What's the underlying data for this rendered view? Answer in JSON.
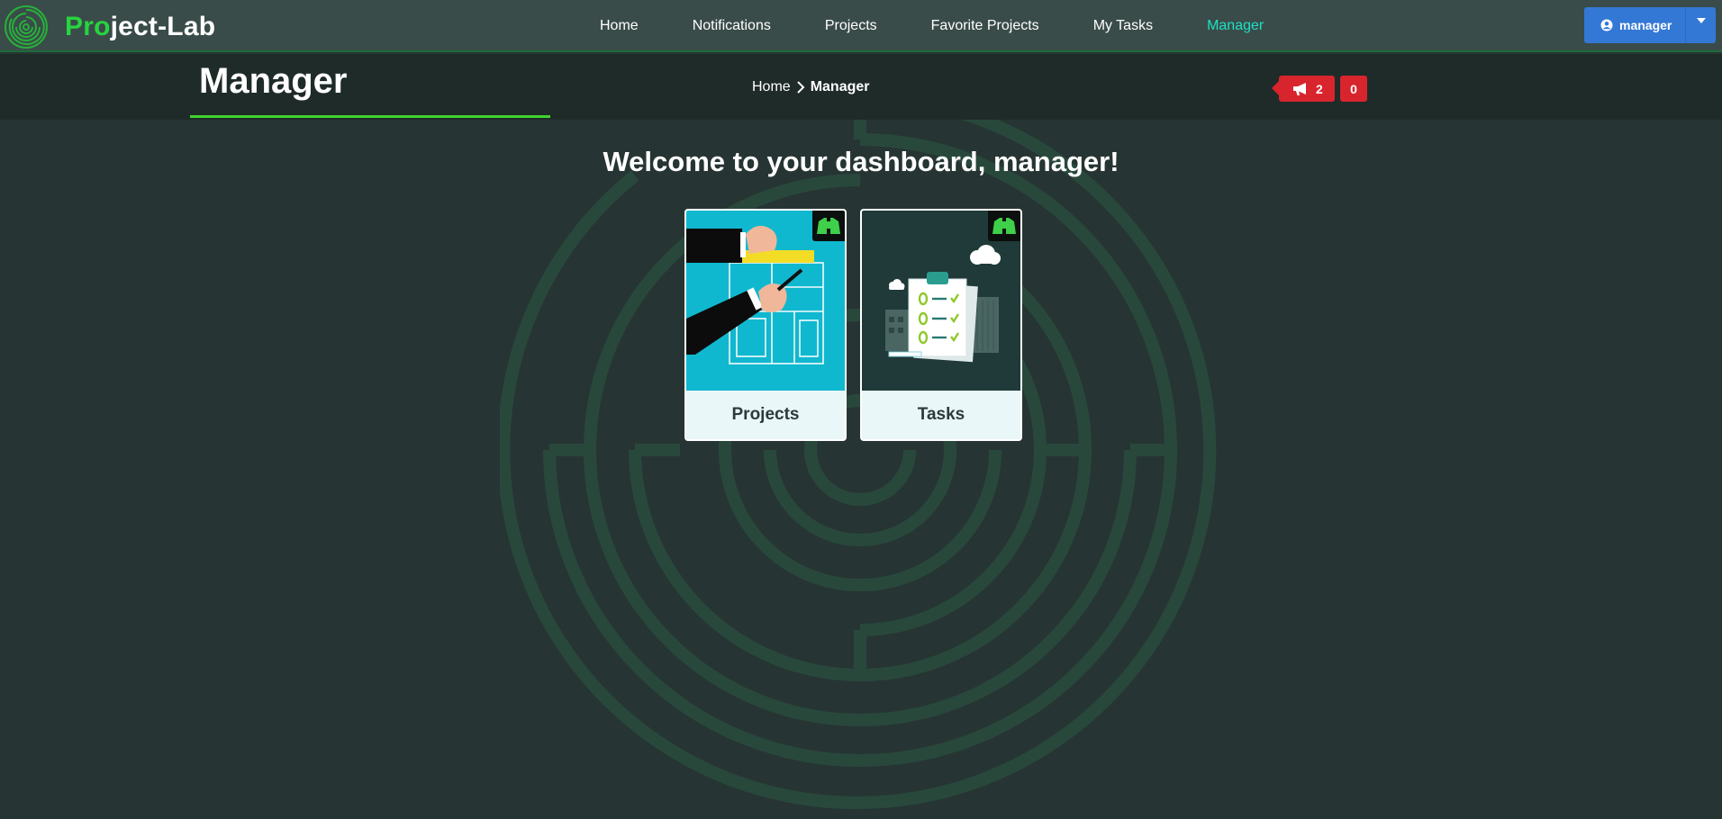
{
  "brand": {
    "part1": "Pro",
    "part2": "ject-Lab"
  },
  "nav": {
    "items": [
      {
        "label": "Home"
      },
      {
        "label": "Notifications"
      },
      {
        "label": "Projects"
      },
      {
        "label": "Favorite Projects"
      },
      {
        "label": "My Tasks"
      },
      {
        "label": "Manager",
        "active": true
      }
    ]
  },
  "user_menu": {
    "label": "manager",
    "icon": "user-circle-icon"
  },
  "header": {
    "title": "Manager",
    "breadcrumb": {
      "home": "Home",
      "current": "Manager"
    },
    "announcement_count": "2",
    "alert_count": "0"
  },
  "main": {
    "welcome": "Welcome to your dashboard, manager!",
    "cards": [
      {
        "label": "Projects",
        "icon": "binoculars-icon"
      },
      {
        "label": "Tasks",
        "icon": "binoculars-icon"
      }
    ]
  },
  "colors": {
    "background": "#263533",
    "navbar": "#3a4c49",
    "accent_green": "#27d43f",
    "active_link": "#1de0c4",
    "user_button": "#3478d6",
    "badge_red": "#d8252d"
  }
}
